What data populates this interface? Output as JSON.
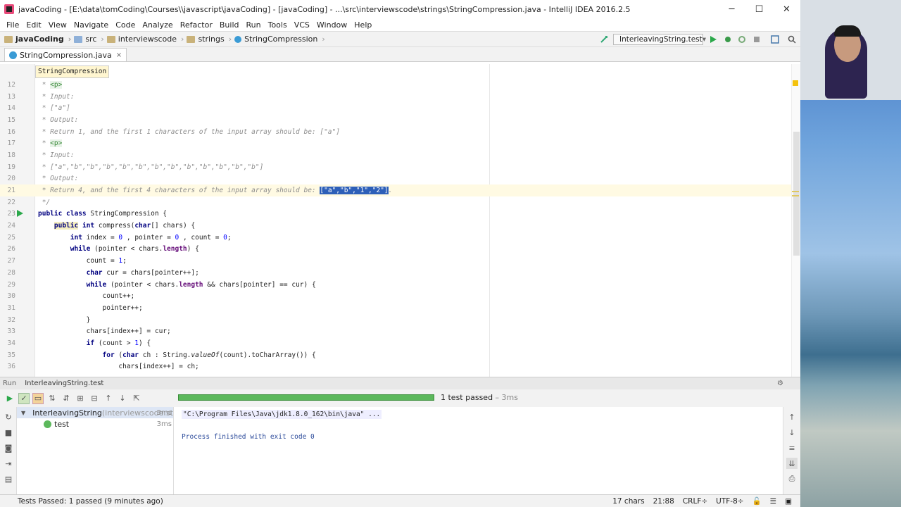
{
  "window": {
    "title": "javaCoding - [E:\\data\\tomCoding\\Courses\\\\javascript\\javaCoding] - [javaCoding] - ...\\src\\interviewscode\\strings\\StringCompression.java - IntelliJ IDEA 2016.2.5"
  },
  "menu": [
    "File",
    "Edit",
    "View",
    "Navigate",
    "Code",
    "Analyze",
    "Refactor",
    "Build",
    "Run",
    "Tools",
    "VCS",
    "Window",
    "Help"
  ],
  "breadcrumbs": [
    "javaCoding",
    "src",
    "interviewscode",
    "strings",
    "StringCompression"
  ],
  "run_config": "InterleavingString.test",
  "tab": {
    "label": "StringCompression.java",
    "close": "×"
  },
  "hint": "StringCompression",
  "code": [
    {
      "n": "12",
      "parts": [
        [
          "cm",
          " * "
        ],
        [
          "tagp",
          "<p>"
        ]
      ]
    },
    {
      "n": "13",
      "parts": [
        [
          "cm",
          " * Input:"
        ]
      ]
    },
    {
      "n": "14",
      "parts": [
        [
          "cm",
          " * [\"a\"]"
        ]
      ]
    },
    {
      "n": "15",
      "parts": [
        [
          "cm",
          " * Output:"
        ]
      ]
    },
    {
      "n": "16",
      "parts": [
        [
          "cm",
          " * Return 1, and the first 1 characters of the input array should be: [\"a\"]"
        ]
      ]
    },
    {
      "n": "17",
      "parts": [
        [
          "cm",
          " * "
        ],
        [
          "tagp",
          "<p>"
        ]
      ]
    },
    {
      "n": "18",
      "parts": [
        [
          "cm",
          " * Input:"
        ]
      ]
    },
    {
      "n": "19",
      "parts": [
        [
          "cm",
          " * [\"a\",\"b\",\"b\",\"b\",\"b\",\"b\",\"b\",\"b\",\"b\",\"b\",\"b\",\"b\",\"b\"]"
        ]
      ]
    },
    {
      "n": "20",
      "parts": [
        [
          "cm",
          " * Output:"
        ]
      ]
    },
    {
      "n": "21",
      "cur": true,
      "parts": [
        [
          "cm",
          " * Return 4, and the first 4 characters of the input array should be: "
        ],
        [
          "sel",
          "[\"a\",\"b\",\"1\",\"2\"]"
        ],
        [
          "cm",
          "."
        ]
      ]
    },
    {
      "n": "22",
      "parts": [
        [
          "cm",
          " */"
        ]
      ]
    },
    {
      "n": "23",
      "parts": [
        [
          "kw",
          "public class "
        ],
        [
          "",
          "StringCompression {"
        ]
      ]
    },
    {
      "n": "24",
      "parts": [
        [
          "",
          "    "
        ],
        [
          "kw hl",
          "public"
        ],
        [
          "kw",
          " int "
        ],
        [
          "",
          "compress("
        ],
        [
          "kw",
          "char"
        ],
        [
          "",
          "[] chars) {"
        ]
      ]
    },
    {
      "n": "25",
      "parts": [
        [
          "",
          "        "
        ],
        [
          "kw",
          "int "
        ],
        [
          "",
          "index = "
        ],
        [
          "num-l",
          "0"
        ],
        [
          "",
          " , pointer = "
        ],
        [
          "num-l",
          "0"
        ],
        [
          "",
          " , count = "
        ],
        [
          "num-l",
          "0"
        ],
        [
          "",
          ";"
        ]
      ]
    },
    {
      "n": "26",
      "parts": [
        [
          "",
          "        "
        ],
        [
          "kw",
          "while "
        ],
        [
          "",
          "(pointer < chars."
        ],
        [
          "field",
          "length"
        ],
        [
          "",
          ") {"
        ]
      ]
    },
    {
      "n": "27",
      "parts": [
        [
          "",
          "            count = "
        ],
        [
          "num-l",
          "1"
        ],
        [
          "",
          ";"
        ]
      ]
    },
    {
      "n": "28",
      "parts": [
        [
          "",
          "            "
        ],
        [
          "kw",
          "char "
        ],
        [
          "",
          "cur = chars[pointer++];"
        ]
      ]
    },
    {
      "n": "29",
      "parts": [
        [
          "",
          "            "
        ],
        [
          "kw",
          "while "
        ],
        [
          "",
          "(pointer < chars."
        ],
        [
          "field",
          "length"
        ],
        [
          "",
          " && chars[pointer] == cur) {"
        ]
      ]
    },
    {
      "n": "30",
      "parts": [
        [
          "",
          "                count++;"
        ]
      ]
    },
    {
      "n": "31",
      "parts": [
        [
          "",
          "                pointer++;"
        ]
      ]
    },
    {
      "n": "32",
      "parts": [
        [
          "",
          "            }"
        ]
      ]
    },
    {
      "n": "33",
      "parts": [
        [
          "",
          "            chars[index++] = cur;"
        ]
      ]
    },
    {
      "n": "34",
      "parts": [
        [
          "",
          "            "
        ],
        [
          "kw",
          "if "
        ],
        [
          "",
          "(count > "
        ],
        [
          "num-l",
          "1"
        ],
        [
          "",
          ") {"
        ]
      ]
    },
    {
      "n": "35",
      "parts": [
        [
          "",
          "                "
        ],
        [
          "kw",
          "for "
        ],
        [
          "",
          "("
        ],
        [
          "kw",
          "char "
        ],
        [
          "",
          "ch : String."
        ],
        [
          "static",
          "valueOf"
        ],
        [
          "",
          "(count).toCharArray()) {"
        ]
      ]
    },
    {
      "n": "36",
      "parts": [
        [
          "",
          "                    chars[index++] = ch;"
        ]
      ]
    }
  ],
  "run": {
    "label": "Run",
    "config": "InterleavingString.test",
    "progress": 1.0,
    "result": "1 test passed",
    "result_time": " – 3ms",
    "tree": [
      {
        "name": "InterleavingString",
        "pkg": " (interviewscode.str",
        "time": "3ms"
      },
      {
        "name": "test",
        "pkg": "",
        "time": "3ms"
      }
    ],
    "console_cmd": "\"C:\\Program Files\\Java\\jdk1.8.0_162\\bin\\java\" ...",
    "console_exit": "Process finished with exit code 0"
  },
  "status": {
    "message": "Tests Passed: 1 passed (9 minutes ago)",
    "chars": "17 chars",
    "pos": "21:88",
    "line_sep": "CRLF÷",
    "encoding": "UTF-8÷"
  }
}
